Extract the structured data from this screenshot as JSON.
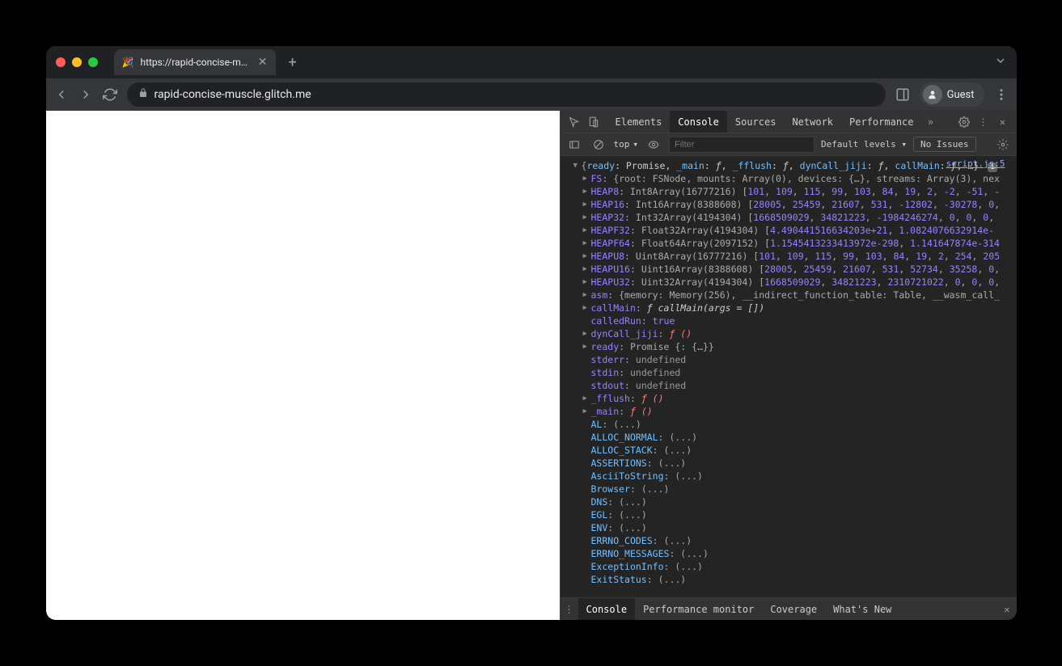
{
  "tab": {
    "title": "https://rapid-concise-muscle.g"
  },
  "toolbar": {
    "url": "rapid-concise-muscle.glitch.me",
    "guest_label": "Guest"
  },
  "devtools": {
    "tabs": [
      "Elements",
      "Console",
      "Sources",
      "Network",
      "Performance"
    ],
    "active_tab": "Console",
    "console_toolbar": {
      "context": "top",
      "filter_placeholder": "Filter",
      "levels_label": "Default levels",
      "issues_label": "No Issues"
    },
    "source_link": "script.js:5",
    "summary": "{ready: Promise, _main: ƒ, _fflush: ƒ, dynCall_jiji: ƒ, callMain: ƒ, …}",
    "rows": [
      {
        "expand": true,
        "key": "FS",
        "text": ": {root: FSNode, mounts: Array(0), devices: {…}, streams: Array(3), nex"
      },
      {
        "expand": true,
        "key": "HEAP8",
        "pre": ": Int8Array(16777216) [",
        "nums": [
          "101",
          "109",
          "115",
          "99",
          "103",
          "84",
          "19",
          "2",
          "-2",
          "-51",
          "-"
        ]
      },
      {
        "expand": true,
        "key": "HEAP16",
        "pre": ": Int16Array(8388608) [",
        "nums": [
          "28005",
          "25459",
          "21607",
          "531",
          "-12802",
          "-30278",
          "0",
          ""
        ]
      },
      {
        "expand": true,
        "key": "HEAP32",
        "pre": ": Int32Array(4194304) [",
        "nums": [
          "1668509029",
          "34821223",
          "-1984246274",
          "0",
          "0",
          "0",
          ""
        ]
      },
      {
        "expand": true,
        "key": "HEAPF32",
        "pre": ": Float32Array(4194304) [",
        "nums": [
          "4.490441516634203e+21",
          "1.0824076632914e-"
        ]
      },
      {
        "expand": true,
        "key": "HEAPF64",
        "pre": ": Float64Array(2097152) [",
        "nums": [
          "1.1545413233413972e-298",
          "1.141647874e-314"
        ]
      },
      {
        "expand": true,
        "key": "HEAPU8",
        "pre": ": Uint8Array(16777216) [",
        "nums": [
          "101",
          "109",
          "115",
          "99",
          "103",
          "84",
          "19",
          "2",
          "254",
          "205"
        ]
      },
      {
        "expand": true,
        "key": "HEAPU16",
        "pre": ": Uint16Array(8388608) [",
        "nums": [
          "28005",
          "25459",
          "21607",
          "531",
          "52734",
          "35258",
          "0",
          ""
        ]
      },
      {
        "expand": true,
        "key": "HEAPU32",
        "pre": ": Uint32Array(4194304) [",
        "nums": [
          "1668509029",
          "34821223",
          "2310721022",
          "0",
          "0",
          "0",
          ""
        ]
      },
      {
        "expand": true,
        "key": "asm",
        "text": ": {memory: Memory(256), __indirect_function_table: Table, __wasm_call_"
      },
      {
        "expand": true,
        "key": "callMain",
        "func": "ƒ callMain(args = [])"
      },
      {
        "expand": false,
        "key": "calledRun",
        "val_true": "true"
      },
      {
        "expand": true,
        "key": "dynCall_jiji",
        "func_red": "ƒ ()"
      },
      {
        "expand": true,
        "key": "ready",
        "text": ": Promise {<fulfilled>: {…}}"
      },
      {
        "expand": false,
        "key": "stderr",
        "undef": "undefined"
      },
      {
        "expand": false,
        "key": "stdin",
        "undef": "undefined"
      },
      {
        "expand": false,
        "key": "stdout",
        "undef": "undefined"
      },
      {
        "expand": true,
        "key": "_fflush",
        "func_red": "ƒ ()"
      },
      {
        "expand": true,
        "key": "_main",
        "func_red": "ƒ ()"
      },
      {
        "expand": false,
        "sub": true,
        "key": "AL",
        "text": ": (...)"
      },
      {
        "expand": false,
        "sub": true,
        "key": "ALLOC_NORMAL",
        "text": ": (...)"
      },
      {
        "expand": false,
        "sub": true,
        "key": "ALLOC_STACK",
        "text": ": (...)"
      },
      {
        "expand": false,
        "sub": true,
        "key": "ASSERTIONS",
        "text": ": (...)"
      },
      {
        "expand": false,
        "sub": true,
        "key": "AsciiToString",
        "text": ": (...)"
      },
      {
        "expand": false,
        "sub": true,
        "key": "Browser",
        "text": ": (...)"
      },
      {
        "expand": false,
        "sub": true,
        "key": "DNS",
        "text": ": (...)"
      },
      {
        "expand": false,
        "sub": true,
        "key": "EGL",
        "text": ": (...)"
      },
      {
        "expand": false,
        "sub": true,
        "key": "ENV",
        "text": ": (...)"
      },
      {
        "expand": false,
        "sub": true,
        "key": "ERRNO_CODES",
        "text": ": (...)"
      },
      {
        "expand": false,
        "sub": true,
        "key": "ERRNO_MESSAGES",
        "text": ": (...)"
      },
      {
        "expand": false,
        "sub": true,
        "key": "ExceptionInfo",
        "text": ": (...)"
      },
      {
        "expand": false,
        "sub": true,
        "key": "ExitStatus",
        "text": ": (...)"
      }
    ],
    "drawer_tabs": [
      "Console",
      "Performance monitor",
      "Coverage",
      "What's New"
    ],
    "drawer_active": "Console"
  }
}
